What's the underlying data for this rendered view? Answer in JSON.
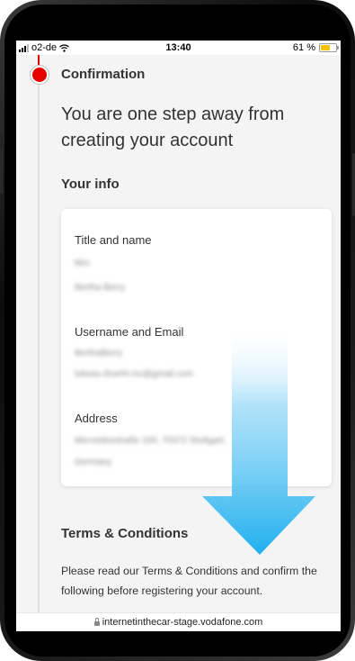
{
  "status_bar": {
    "carrier": "o2-de",
    "time": "13:40",
    "battery_percent": "61 %",
    "battery_level": 0.61,
    "battery_color": "#f5c400"
  },
  "stepper": {
    "active_color": "#e60000",
    "step_title": "Confirmation"
  },
  "headline": "You are one step away from creating your account",
  "your_info": {
    "title": "Your info",
    "title_and_name_label": "Title and name",
    "title_value": "Mrs",
    "name_value": "Bertha Berry",
    "username_email_label": "Username and Email",
    "username_value": "BerthaBerry",
    "email_value": "lukeas.drueht.mc@gmail.com",
    "address_label": "Address",
    "address_line1": "Mercedesstraße 100, 70372 Stuttgart,",
    "address_line2": "Germany"
  },
  "terms": {
    "title": "Terms & Conditions",
    "text": "Please read our Terms & Conditions and confirm the following before registering your account."
  },
  "browser": {
    "url": "internetinthecar-stage.vodafone.com"
  },
  "overlay": {
    "arrow_color": "#1fb0ef"
  }
}
